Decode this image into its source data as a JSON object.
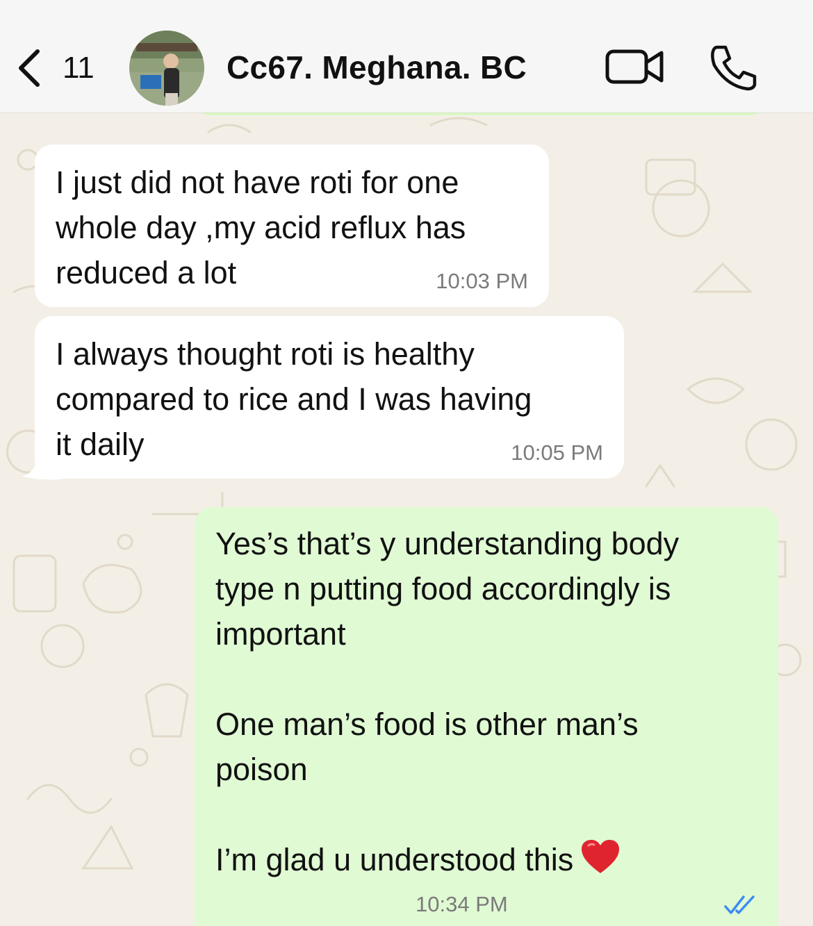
{
  "header": {
    "unread_count": "11",
    "contact_name": "Cc67. Meghana. BC",
    "icons": {
      "back": "chevron-left-icon",
      "video": "video-camera-icon",
      "call": "phone-icon"
    }
  },
  "messages": [
    {
      "direction": "incoming",
      "text": "I just did not have roti for one\nwhole day ,my acid reflux has\nreduced a lot",
      "time": "10:03 PM"
    },
    {
      "direction": "incoming",
      "text": "I always thought roti is healthy\ncompared to rice and I was having\nit daily",
      "time": "10:05 PM"
    },
    {
      "direction": "outgoing",
      "text": "Yes’s that’s y understanding body\ntype n putting food accordingly is\nimportant\n\nOne man’s food is other man’s\npoison\n\nI’m glad u understood this",
      "emoji": "heart-emoji",
      "time": "10:34 PM",
      "status": "read-double-check-icon"
    }
  ],
  "colors": {
    "outgoing_bubble": "#e0fad4",
    "incoming_bubble": "#ffffff",
    "read_ticks": "#3d8bf2",
    "wallpaper": "#f3efe7"
  }
}
